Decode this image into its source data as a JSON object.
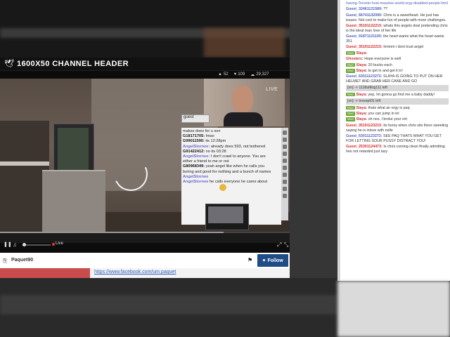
{
  "player": {
    "title": "1600X50 CHANNEL HEADER",
    "stats": {
      "likes": "52",
      "hearts": "109",
      "viewers": "29,327"
    },
    "cam_badge": "LIVE",
    "controls": {
      "live_label": "Live",
      "pause_icon": "pause-icon",
      "volume_icon": "volume-icon",
      "fullscreen_icon": "fullscreen-icon"
    }
  },
  "video_chat": {
    "tab": "guest",
    "messages": [
      {
        "name": "",
        "text": "makes does for u son"
      },
      {
        "name": "G18171705:",
        "text": "lmao"
      },
      {
        "name": "G99011590:",
        "text": "its 12:28pm"
      },
      {
        "name": "AngelStornee:",
        "text": "already does 593, not bothered"
      },
      {
        "name": "G91422412:",
        "text": "no its 03:28"
      },
      {
        "name": "AngelStornee:",
        "text": "I don't crawl to anyone. You are either a friend to me or not"
      },
      {
        "name": "G80968349:",
        "text": "yeah angel like when he calls you boring and good for nothing and a bunch of names"
      },
      {
        "name": "AngelStornee",
        "text": ""
      },
      {
        "name": "AngelStornee",
        "text": "he calls everyone he cares about"
      }
    ]
  },
  "channel": {
    "name": "Paquet90",
    "follow_label": "Follow",
    "link": "https://www.facebook.com/um.paquet"
  },
  "chat": {
    "messages": [
      {
        "type": "text",
        "text": "having-Toronto-host-massive-world-orgy-disabled-people.html"
      },
      {
        "type": "guest",
        "name": "Guest_32461121589:",
        "text": "??"
      },
      {
        "type": "guest",
        "name": "Guest_66741132090:",
        "text": "Chris is a sweetheart. He just has issues. Not cool to make fun of people with more challenges."
      },
      {
        "type": "guest-red",
        "name": "Guest_35191122215:",
        "text": "whats this angels deal pretending chris is the ideal man love of her life"
      },
      {
        "type": "guest",
        "name": "Guest_91871121100:",
        "text": "the heart wants what the heart wants 351"
      },
      {
        "type": "guest-red",
        "name": "Guest_35191122215:",
        "text": "hmmm i dont trust angel"
      },
      {
        "type": "mod",
        "badge": "Mod",
        "name": "Slaya:",
        "text": ""
      },
      {
        "type": "ghost",
        "name": "Ghosterz:",
        "text": "Hope everyone is well"
      },
      {
        "type": "mod",
        "badge": "Mod",
        "name": "Slaya:",
        "text": "20 bucks each"
      },
      {
        "type": "mod",
        "badge": "Mod",
        "name": "Slaya:",
        "text": "to get in and get it in!"
      },
      {
        "type": "guest",
        "name": "Guest_63011123272:",
        "text": "SLAYA IS GOING TO PUT ON HER HELMET AND GRAB HER CANE AND GO"
      },
      {
        "type": "sys",
        "text": "[vn] -> 1118ultfog111 left"
      },
      {
        "type": "mod",
        "badge": "Mod",
        "name": "Slaya:",
        "text": "yep, Im gonna go find me a baby daddy!"
      },
      {
        "type": "sys",
        "text": "[vn] -> trouept01 left"
      },
      {
        "type": "mod",
        "badge": "Mod",
        "name": "Slaya:",
        "text": "thats what an orgy is paq"
      },
      {
        "type": "mod",
        "badge": "Mod",
        "name": "Slaya:",
        "text": "you can jump in lol"
      },
      {
        "type": "mod",
        "badge": "Mod",
        "name": "Slaya:",
        "text": "oh nos, I broke your virt"
      },
      {
        "type": "guest-red",
        "name": "Guest_35191123215:",
        "text": "its funny when chris sits there sweeting saying he is inlove with nelle"
      },
      {
        "type": "guest",
        "name": "Guest_63011123272:",
        "text": "SEE PAQ THATS WHAT YOU GET FOR LETTING SOUR PUSSY DISTRACT YOU!"
      },
      {
        "type": "guest-red",
        "name": "Guest_25301124473:",
        "text": "Is chris coming clean finally admitting hes not retarded just lazy"
      }
    ]
  },
  "colors": {
    "follow": "#1e4c86",
    "mod_badge": "#6aa531",
    "guest_name": "#4f5fb8",
    "red_name": "#d2292c",
    "live_dot": "#e8333a"
  }
}
